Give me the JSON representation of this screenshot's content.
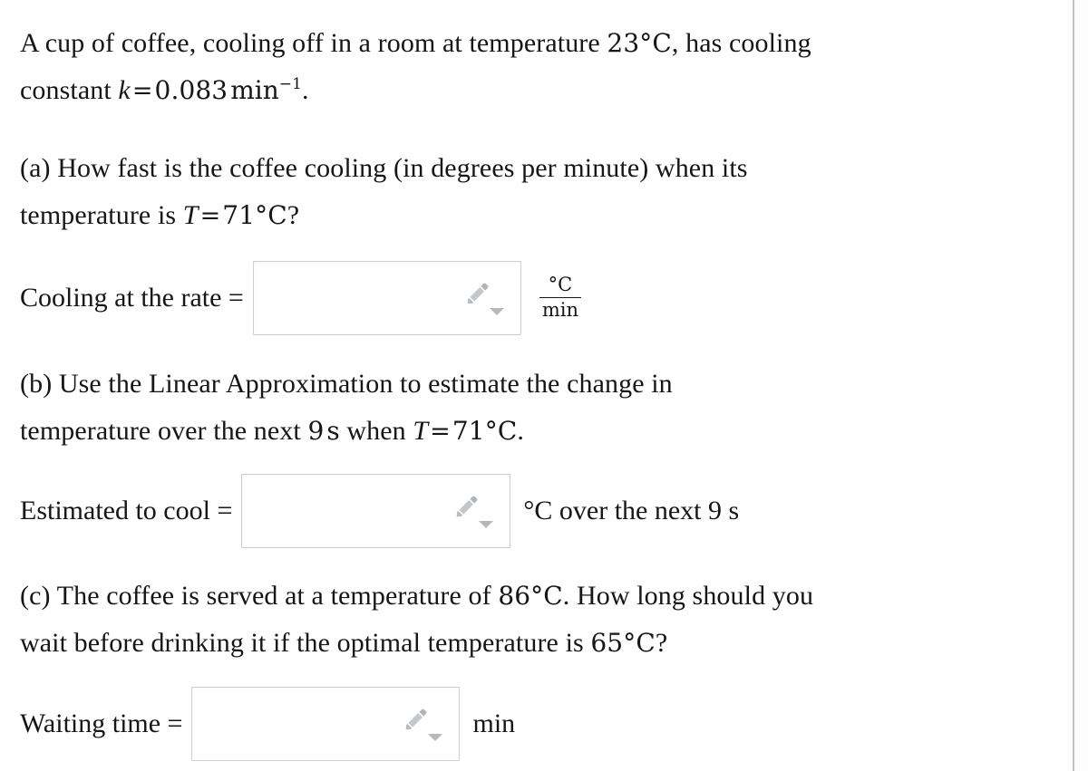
{
  "problem": {
    "stem": {
      "line1_pre": "A cup of coffee, cooling off in a room at temperature ",
      "ambient_temperature": "23",
      "degree_symbol": "°",
      "celsius": "C",
      "line1_post": ", has cooling",
      "line2_pre": "constant ",
      "constant_symbol": "k",
      "equals": "=",
      "cooling_constant": "0.083",
      "constant_unit": "min",
      "constant_exponent": "−1",
      "line2_post": "."
    },
    "parts": [
      {
        "id": "a",
        "marker": "(a)",
        "text_pre": " How fast is the coffee cooling (in degrees per minute) when its",
        "text_line2_pre": "temperature is ",
        "variable": "T",
        "equals": "=",
        "value": "71",
        "degree_symbol": "°",
        "celsius": "C",
        "text_line2_post": "?"
      },
      {
        "id": "b",
        "marker": "(b)",
        "text_pre": " Use the Linear Approximation to estimate the change in",
        "text_line2_pre": "temperature over the next ",
        "interval_value": "9",
        "interval_unit": "s",
        "text_line2_mid": " when ",
        "variable": "T",
        "equals": "=",
        "value": "71",
        "degree_symbol": "°",
        "celsius": "C",
        "text_line2_post": "."
      },
      {
        "id": "c",
        "marker": "(c)",
        "text_pre": " The coffee is served at a temperature of ",
        "served_temperature": "86",
        "degree_symbol": "°",
        "celsius": "C",
        "text_line1_post": ". How long should you",
        "text_line2_pre": "wait before drinking it if the optimal temperature is ",
        "optimal_temperature": "65",
        "text_line2_post": "?"
      }
    ],
    "answers": [
      {
        "id": "a",
        "label": "Cooling at the rate =",
        "value": "",
        "placeholder": "",
        "unit_numerator": "°C",
        "unit_denominator": "min",
        "icon": "pencil-icon",
        "caret_icon": "caret-down-icon"
      },
      {
        "id": "b",
        "label": "Estimated to cool =",
        "value": "",
        "placeholder": "",
        "unit_text": "°C over the next 9 s",
        "icon": "pencil-icon",
        "caret_icon": "caret-down-icon"
      },
      {
        "id": "c",
        "label": "Waiting time =",
        "value": "",
        "placeholder": "",
        "unit_text": "min",
        "icon": "pencil-icon",
        "caret_icon": "caret-down-icon"
      }
    ]
  },
  "colors": {
    "text": "#161616",
    "field_border": "#cfcfcf",
    "icon_grey": "#b3b9bd",
    "pane_divider": "#b9c3ca",
    "background": "#ffffff"
  }
}
